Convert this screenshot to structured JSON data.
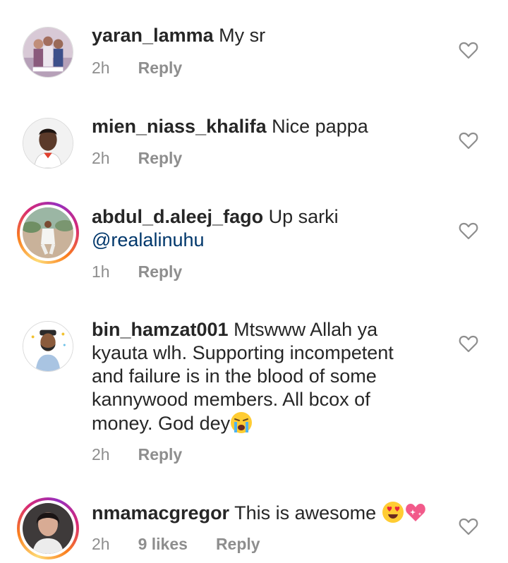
{
  "comments": [
    {
      "username": "yaran_lamma",
      "text": "My sr",
      "time": "2h",
      "reply": "Reply",
      "likes": "",
      "story_ring": false,
      "avatar_icon": "group-photo-avatar"
    },
    {
      "username": "mien_niass_khalifa",
      "text": "Nice pappa",
      "time": "2h",
      "reply": "Reply",
      "likes": "",
      "story_ring": false,
      "avatar_icon": "portrait-avatar"
    },
    {
      "username": "abdul_d.aleej_fago",
      "text": "Up sarki",
      "mention": "@realalinuhu",
      "time": "1h",
      "reply": "Reply",
      "likes": "",
      "story_ring": true,
      "avatar_icon": "outdoor-photo-avatar"
    },
    {
      "username": "bin_hamzat001",
      "text": "Mtswww Allah ya kyauta wlh. Supporting incompetent and failure is in the blood of some kannywood members. All bcox of money. God dey",
      "emoji": "loudly-crying-face-emoji",
      "time": "2h",
      "reply": "Reply",
      "likes": "",
      "story_ring": false,
      "avatar_icon": "cartoon-avatar"
    },
    {
      "username": "nmamacgregor",
      "text": "This is awesome",
      "emoji": "heart-eyes-emoji, sparkling-heart-emoji",
      "time": "2h",
      "reply": "Reply",
      "likes": "9 likes",
      "story_ring": true,
      "avatar_icon": "selfie-avatar"
    }
  ],
  "colors": {
    "text": "#262626",
    "meta": "#8e8e8e",
    "mention": "#00376b",
    "heart_outline": "#8e8e8e"
  }
}
